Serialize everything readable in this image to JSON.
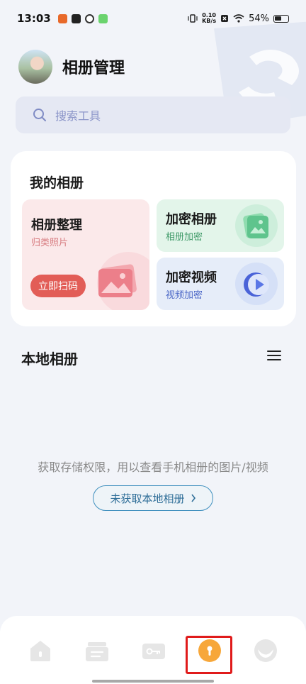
{
  "status_bar": {
    "time": "13:03",
    "net_speed_value": "0.10",
    "net_speed_unit": "KB/s",
    "battery": "54%"
  },
  "header": {
    "title": "相册管理"
  },
  "search": {
    "placeholder": "搜索工具"
  },
  "my_albums": {
    "title": "我的相册",
    "organize": {
      "title": "相册整理",
      "subtitle": "归类照片",
      "button": "立即扫码"
    },
    "encrypted_album": {
      "title": "加密相册",
      "subtitle": "相册加密"
    },
    "encrypted_video": {
      "title": "加密视频",
      "subtitle": "视频加密"
    }
  },
  "local_album": {
    "title": "本地相册",
    "permission_text": "获取存储权限，用以查看手机相册的图片/视频",
    "permission_button": "未获取本地相册"
  },
  "bottom_nav": {
    "items": [
      {
        "icon": "home-icon"
      },
      {
        "icon": "files-icon"
      },
      {
        "icon": "key-icon"
      },
      {
        "icon": "lock-icon",
        "active": true
      },
      {
        "icon": "profile-icon"
      }
    ]
  },
  "colors": {
    "background": "#f2f4f9",
    "accent_red": "#e25d57",
    "active_nav": "#f7a73a",
    "highlight": "#e01b1b"
  }
}
